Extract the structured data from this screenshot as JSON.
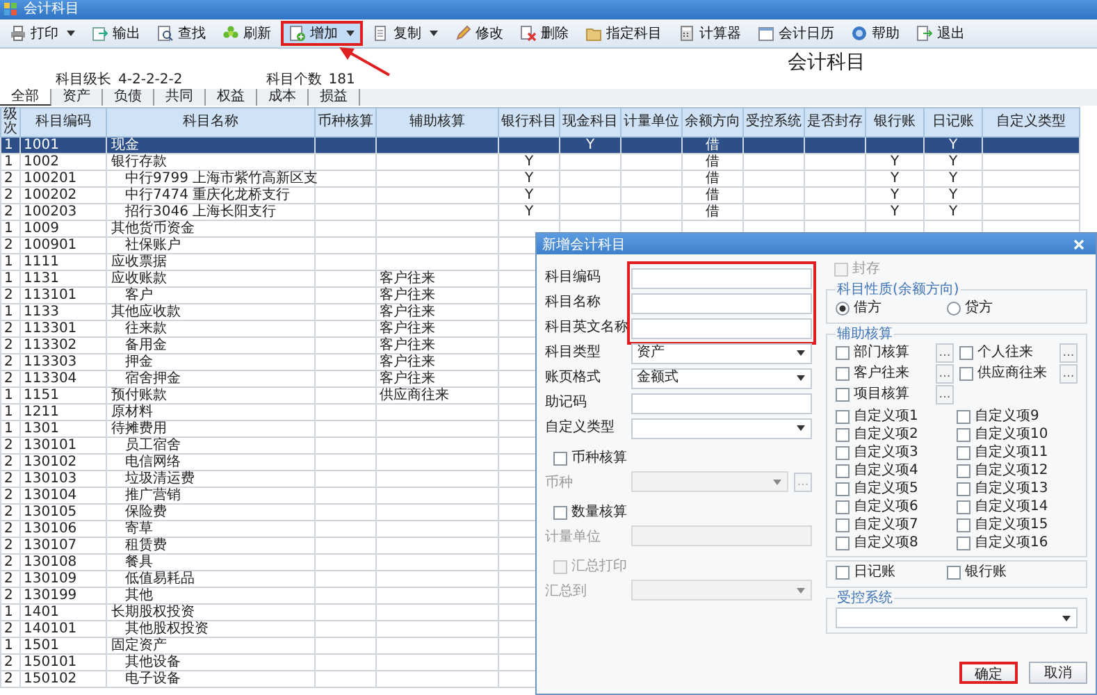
{
  "window": {
    "title": "会计科目"
  },
  "toolbar": [
    {
      "label": "打印",
      "dropdown": true,
      "highlighted": false
    },
    {
      "label": "输出",
      "dropdown": false,
      "highlighted": false
    },
    {
      "label": "查找",
      "dropdown": false,
      "highlighted": false
    },
    {
      "label": "刷新",
      "dropdown": false,
      "highlighted": false
    },
    {
      "label": "增加",
      "dropdown": true,
      "highlighted": true
    },
    {
      "label": "复制",
      "dropdown": true,
      "highlighted": false
    },
    {
      "label": "修改",
      "dropdown": false,
      "highlighted": false
    },
    {
      "label": "删除",
      "dropdown": false,
      "highlighted": false
    },
    {
      "label": "指定科目",
      "dropdown": false,
      "highlighted": false
    },
    {
      "label": "计算器",
      "dropdown": false,
      "highlighted": false
    },
    {
      "label": "会计日历",
      "dropdown": false,
      "highlighted": false
    },
    {
      "label": "帮助",
      "dropdown": false,
      "highlighted": false
    },
    {
      "label": "退出",
      "dropdown": false,
      "highlighted": false
    }
  ],
  "heading": "会计科目",
  "info": [
    {
      "label": "科目级长",
      "value": "4-2-2-2-2"
    },
    {
      "label": "科目个数",
      "value": "181"
    }
  ],
  "tabs": [
    {
      "label": "全部",
      "selected": true
    },
    {
      "label": "资产",
      "selected": false
    },
    {
      "label": "负债",
      "selected": false
    },
    {
      "label": "共同",
      "selected": false
    },
    {
      "label": "权益",
      "selected": false
    },
    {
      "label": "成本",
      "selected": false
    },
    {
      "label": "损益",
      "selected": false
    }
  ],
  "table": {
    "columns": [
      "级次",
      "科目编码",
      "科目名称",
      "币种核算",
      "辅助核算",
      "银行科目",
      "现金科目",
      "计量单位",
      "余额方向",
      "受控系统",
      "是否封存",
      "银行账",
      "日记账",
      "自定义类型"
    ],
    "rows": [
      {
        "level": "1",
        "code": "1001",
        "name": "现金",
        "cash_account": "Y",
        "direction": "借",
        "journal": "Y",
        "selected": true
      },
      {
        "level": "1",
        "code": "1002",
        "name": "银行存款",
        "bank_account": "Y",
        "direction": "借",
        "bank_book": "Y",
        "journal": "Y",
        "selected": false,
        "children": [
          {
            "level": "2",
            "code": "100201",
            "name": "中行9799  上海市紫竹高新区支",
            "bank_account": "Y",
            "direction": "借",
            "bank_book": "Y",
            "journal": "Y",
            "selected": false
          },
          {
            "level": "2",
            "code": "100202",
            "name": "中行7474  重庆化龙桥支行",
            "bank_account": "Y",
            "direction": "借",
            "bank_book": "Y",
            "journal": "Y",
            "selected": false
          },
          {
            "level": "2",
            "code": "100203",
            "name": "招行3046  上海长阳支行",
            "bank_account": "Y",
            "direction": "借",
            "bank_book": "Y",
            "journal": "Y",
            "selected": false
          }
        ]
      },
      {
        "level": "1",
        "code": "1009",
        "name": "其他货币资金",
        "selected": false,
        "children": [
          {
            "level": "2",
            "code": "100901",
            "name": "社保账户",
            "selected": false
          }
        ]
      },
      {
        "level": "1",
        "code": "1111",
        "name": "应收票据",
        "selected": false
      },
      {
        "level": "1",
        "code": "1131",
        "name": "应收账款",
        "auxiliary": "客户往来",
        "selected": false,
        "children": [
          {
            "level": "2",
            "code": "113101",
            "name": "客户",
            "auxiliary": "客户往来",
            "selected": false
          }
        ]
      },
      {
        "level": "1",
        "code": "1133",
        "name": "其他应收款",
        "auxiliary": "客户往来",
        "selected": false,
        "children": [
          {
            "level": "2",
            "code": "113301",
            "name": "往来款",
            "auxiliary": "客户往来",
            "selected": false
          },
          {
            "level": "2",
            "code": "113302",
            "name": "备用金",
            "auxiliary": "客户往来",
            "selected": false
          },
          {
            "level": "2",
            "code": "113303",
            "name": "押金",
            "auxiliary": "客户往来",
            "selected": false
          },
          {
            "level": "2",
            "code": "113304",
            "name": "宿舍押金",
            "auxiliary": "客户往来",
            "selected": false
          }
        ]
      },
      {
        "level": "1",
        "code": "1151",
        "name": "预付账款",
        "auxiliary": "供应商往来",
        "selected": false
      },
      {
        "level": "1",
        "code": "1211",
        "name": "原材料",
        "selected": false
      },
      {
        "level": "1",
        "code": "1301",
        "name": "待摊费用",
        "selected": false,
        "children": [
          {
            "level": "2",
            "code": "130101",
            "name": "员工宿舍",
            "selected": false
          },
          {
            "level": "2",
            "code": "130102",
            "name": "电信网络",
            "selected": false
          },
          {
            "level": "2",
            "code": "130103",
            "name": "垃圾清运费",
            "selected": false
          },
          {
            "level": "2",
            "code": "130104",
            "name": "推广营销",
            "selected": false
          },
          {
            "level": "2",
            "code": "130105",
            "name": "保险费",
            "selected": false
          },
          {
            "level": "2",
            "code": "130106",
            "name": "寄草",
            "selected": false
          },
          {
            "level": "2",
            "code": "130107",
            "name": "租赁费",
            "selected": false
          },
          {
            "level": "2",
            "code": "130108",
            "name": "餐具",
            "selected": false
          },
          {
            "level": "2",
            "code": "130109",
            "name": "低值易耗品",
            "selected": false
          },
          {
            "level": "2",
            "code": "130199",
            "name": "其他",
            "selected": false
          }
        ]
      },
      {
        "level": "1",
        "code": "1401",
        "name": "长期股权投资",
        "selected": false,
        "children": [
          {
            "level": "2",
            "code": "140101",
            "name": "其他股权投资",
            "selected": false
          }
        ]
      },
      {
        "level": "1",
        "code": "1501",
        "name": "固定资产",
        "selected": false,
        "children": [
          {
            "level": "2",
            "code": "150101",
            "name": "其他设备",
            "selected": false
          },
          {
            "level": "2",
            "code": "150102",
            "name": "电子设备",
            "selected": false
          }
        ]
      }
    ]
  },
  "dialog": {
    "title": "新增会计科目",
    "fields": [
      {
        "kind": "input",
        "label": "科目编码",
        "highlighted": true
      },
      {
        "kind": "input",
        "label": "科目名称",
        "highlighted": true
      },
      {
        "kind": "input",
        "label": "科目英文名称",
        "highlighted": true
      },
      {
        "kind": "select",
        "label": "科目类型",
        "value": "资产",
        "highlighted": false
      },
      {
        "kind": "select",
        "label": "账页格式",
        "value": "金额式",
        "highlighted": false
      },
      {
        "kind": "input",
        "label": "助记码",
        "highlighted": false
      },
      {
        "kind": "select",
        "label": "自定义类型",
        "highlighted": false
      }
    ],
    "options": [
      {
        "kind": "check",
        "label": "币种核算",
        "checked": false,
        "disabled": false
      },
      {
        "kind": "select",
        "label": "币种",
        "disabled": true,
        "browse": "..."
      },
      {
        "kind": "check",
        "label": "数量核算",
        "checked": false,
        "disabled": false
      },
      {
        "kind": "input",
        "label": "计量单位",
        "disabled": true
      },
      {
        "kind": "check",
        "label": "汇总打印",
        "checked": false,
        "disabled": true
      },
      {
        "kind": "select",
        "label": "汇总到",
        "disabled": true
      }
    ],
    "sealed": {
      "label": "封存",
      "checked": false,
      "disabled": true
    },
    "balance_direction": {
      "title": "科目性质(余额方向)",
      "options": [
        {
          "label": "借方",
          "selected": true
        },
        {
          "label": "贷方",
          "selected": false
        }
      ]
    },
    "auxiliary": {
      "title": "辅助核算",
      "specials": [
        {
          "label": "部门核算",
          "checked": false,
          "browse": "..."
        },
        {
          "label": "个人往来",
          "checked": false,
          "browse": "..."
        },
        {
          "label": "客户往来",
          "checked": false,
          "browse": "..."
        },
        {
          "label": "供应商往来",
          "checked": false,
          "browse": "..."
        },
        {
          "label": "项目核算",
          "checked": false,
          "browse": "..."
        }
      ],
      "custom": [
        {
          "label": "自定义项1",
          "checked": false
        },
        {
          "label": "自定义项2",
          "checked": false
        },
        {
          "label": "自定义项3",
          "checked": false
        },
        {
          "label": "自定义项4",
          "checked": false
        },
        {
          "label": "自定义项5",
          "checked": false
        },
        {
          "label": "自定义项6",
          "checked": false
        },
        {
          "label": "自定义项7",
          "checked": false
        },
        {
          "label": "自定义项8",
          "checked": false
        },
        {
          "label": "自定义项9",
          "checked": false
        },
        {
          "label": "自定义项10",
          "checked": false
        },
        {
          "label": "自定义项11",
          "checked": false
        },
        {
          "label": "自定义项12",
          "checked": false
        },
        {
          "label": "自定义项13",
          "checked": false
        },
        {
          "label": "自定义项14",
          "checked": false
        },
        {
          "label": "自定义项15",
          "checked": false
        },
        {
          "label": "自定义项16",
          "checked": false
        }
      ]
    },
    "books": [
      {
        "label": "日记账",
        "checked": false
      },
      {
        "label": "银行账",
        "checked": false
      }
    ],
    "controlled_system": {
      "title": "受控系统"
    },
    "buttons": [
      {
        "label": "确定",
        "highlighted": true
      },
      {
        "label": "取消",
        "highlighted": false
      }
    ]
  }
}
